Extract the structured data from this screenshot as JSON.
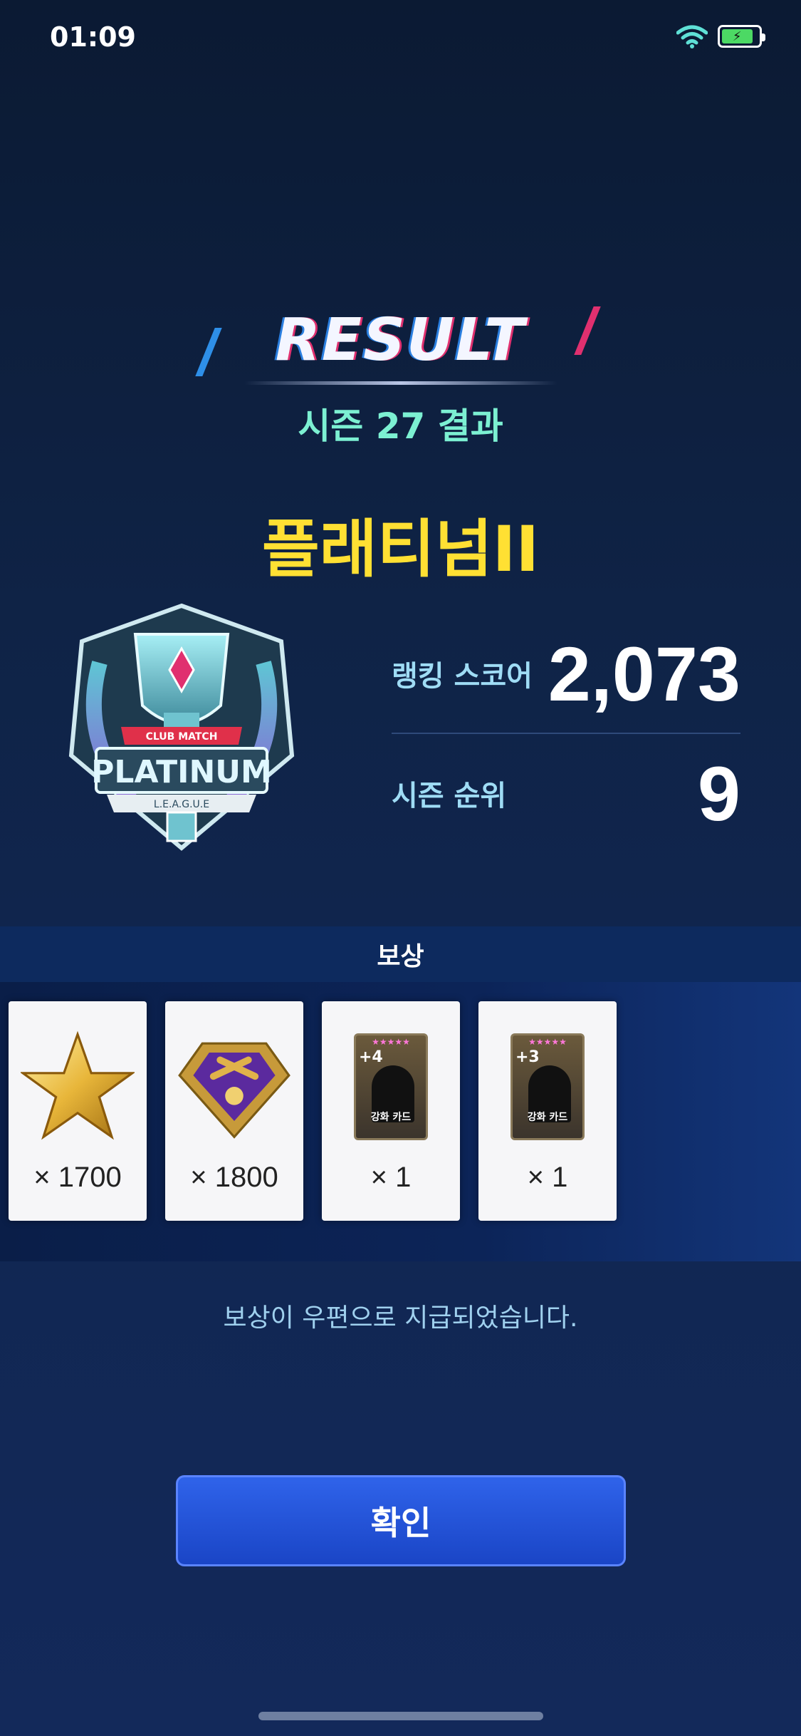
{
  "status_bar": {
    "time": "01:09",
    "battery_level": 0.85,
    "battery_glyph": "⚡"
  },
  "header": {
    "title": "RESULT",
    "season": "시즌 27 결과"
  },
  "tier": {
    "name": "플래티넘II",
    "emblem_text": "PLATINUM",
    "emblem_subtext": "CLUB MATCH",
    "emblem_letters": "L.E.A.G.U.E"
  },
  "stats": {
    "ranking_score_label": "랭킹 스코어",
    "ranking_score_value": "2,073",
    "season_rank_label": "시즌 순위",
    "season_rank_value": "9"
  },
  "rewards": {
    "header": "보상",
    "items": [
      {
        "icon": "gold-star-icon",
        "qty": "× 1700"
      },
      {
        "icon": "purple-diamond-badge-icon",
        "qty": "× 1800"
      },
      {
        "icon": "enhance-card-icon",
        "plus": "+4",
        "stars": "★★★★★",
        "label": "강화 카드",
        "qty": "× 1"
      },
      {
        "icon": "enhance-card-icon",
        "plus": "+3",
        "stars": "★★★★★",
        "label": "강화 카드",
        "qty": "× 1"
      }
    ]
  },
  "notice": "보상이 우편으로 지급되었습니다.",
  "confirm_label": "확인"
}
